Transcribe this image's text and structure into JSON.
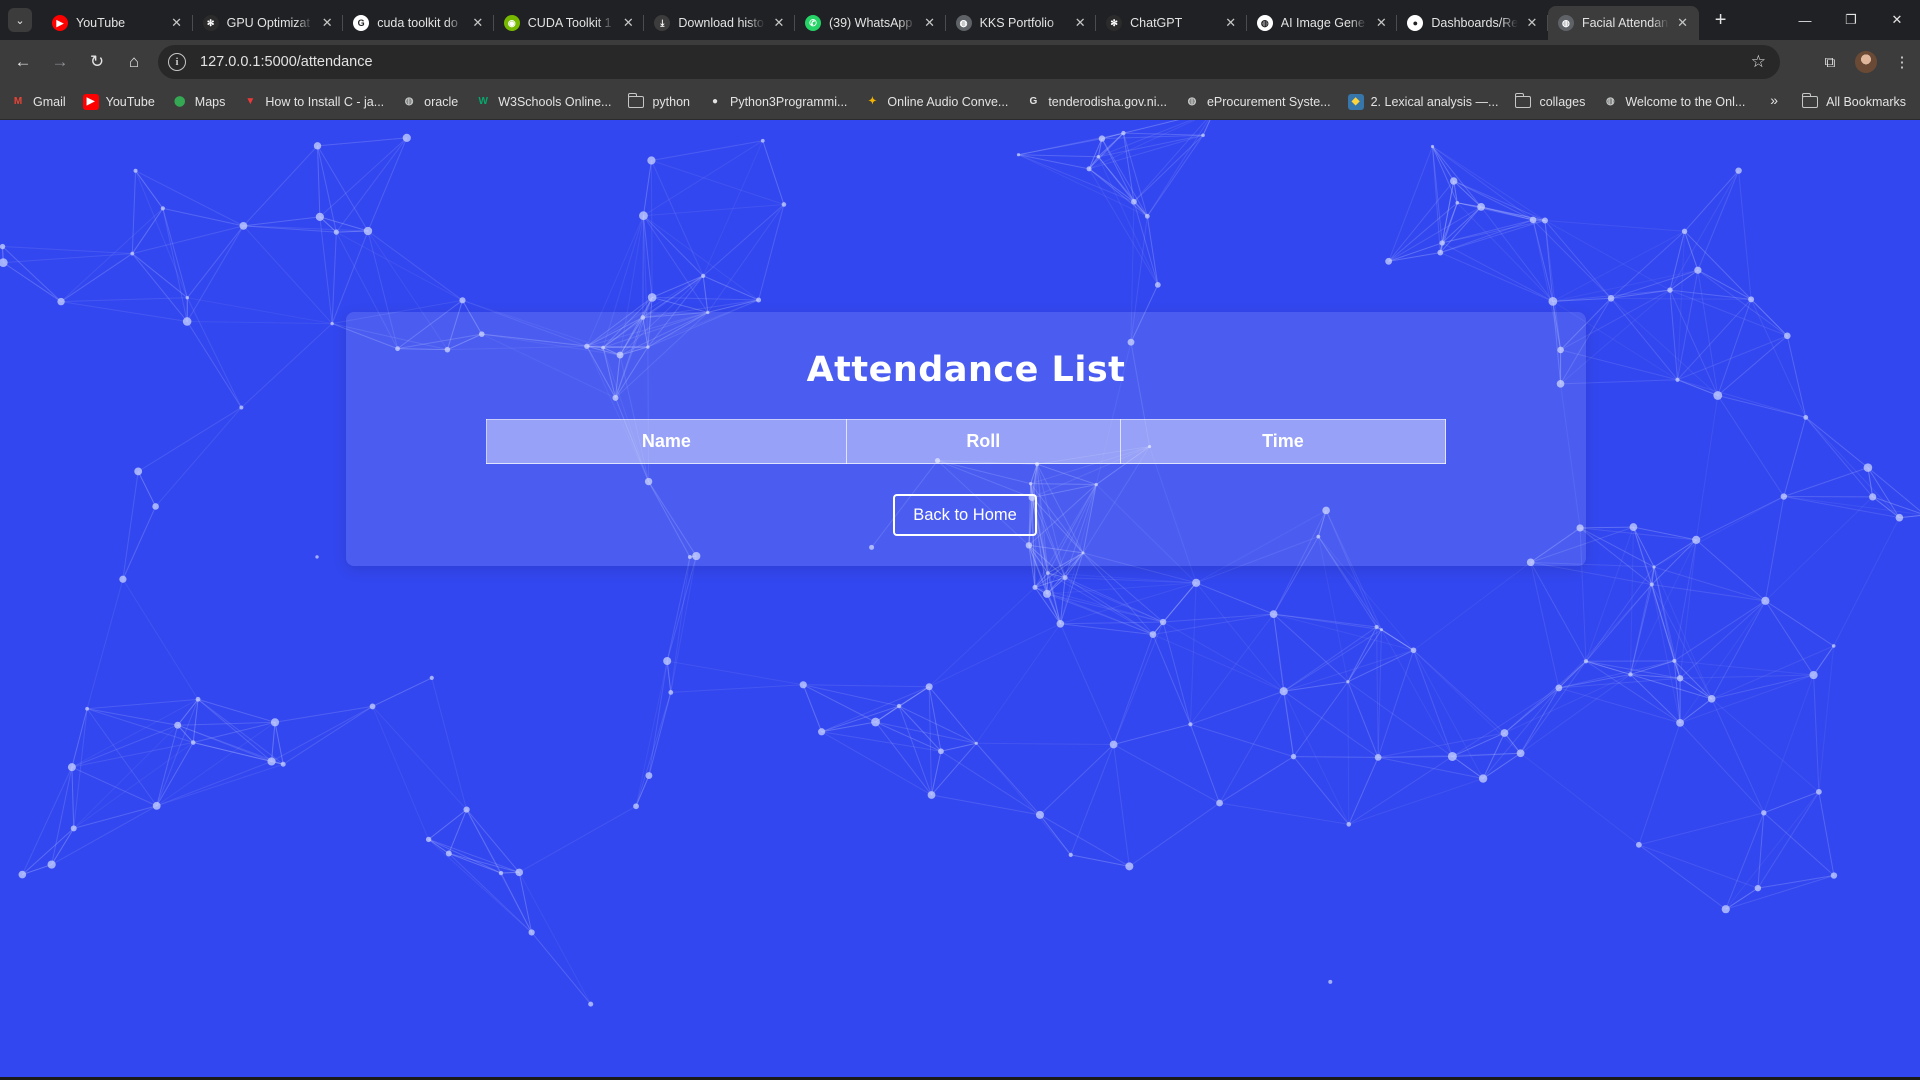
{
  "browser": {
    "tabs": [
      {
        "title": "YouTube",
        "icon": "youtube-icon",
        "color": "#ff0000"
      },
      {
        "title": "GPU Optimizat",
        "icon": "openai-icon",
        "color": "#2b2b2b"
      },
      {
        "title": "cuda toolkit do",
        "icon": "google-icon",
        "color": "#ffffff"
      },
      {
        "title": "CUDA Toolkit 1",
        "icon": "nvidia-icon",
        "color": "#76b900"
      },
      {
        "title": "Download histo",
        "icon": "download-icon",
        "color": "#3c3c3c"
      },
      {
        "title": "(39) WhatsApp",
        "icon": "whatsapp-icon",
        "color": "#25d366"
      },
      {
        "title": "KKS Portfolio",
        "icon": "globe-icon",
        "color": "#5f6368"
      },
      {
        "title": "ChatGPT",
        "icon": "openai-icon",
        "color": "#2b2b2b"
      },
      {
        "title": "AI Image Gene",
        "icon": "globe-icon",
        "color": "#ffffff"
      },
      {
        "title": "Dashboards/Re",
        "icon": "github-icon",
        "color": "#ffffff"
      },
      {
        "title": "Facial Attendan",
        "icon": "globe-icon",
        "color": "#5f6368",
        "active": true
      }
    ],
    "url": "127.0.0.1:5000/attendance",
    "bookmarks": [
      {
        "label": "Gmail",
        "icon": "gmail-icon"
      },
      {
        "label": "YouTube",
        "icon": "youtube-icon"
      },
      {
        "label": "Maps",
        "icon": "maps-icon"
      },
      {
        "label": "How to Install C - ja...",
        "icon": "vivaldi-icon"
      },
      {
        "label": "oracle",
        "icon": "globe-icon"
      },
      {
        "label": "W3Schools Online...",
        "icon": "w3schools-icon"
      },
      {
        "label": "python",
        "icon": "folder-icon"
      },
      {
        "label": "Python3Programmi...",
        "icon": "github-icon"
      },
      {
        "label": "Online Audio Conve...",
        "icon": "audio-converter-icon"
      },
      {
        "label": "tenderodisha.gov.ni...",
        "icon": "google-icon"
      },
      {
        "label": "eProcurement Syste...",
        "icon": "globe-icon"
      },
      {
        "label": "2. Lexical analysis —...",
        "icon": "python-icon"
      },
      {
        "label": "collages",
        "icon": "folder-icon"
      },
      {
        "label": "Welcome to the Onl...",
        "icon": "globe-icon"
      }
    ],
    "all_bookmarks": "All Bookmarks"
  },
  "page": {
    "title": "Attendance List",
    "table_headers": [
      "Name",
      "Roll",
      "Time"
    ],
    "rows": [],
    "back_button": "Back to Home",
    "background_color": "#3347f0"
  }
}
